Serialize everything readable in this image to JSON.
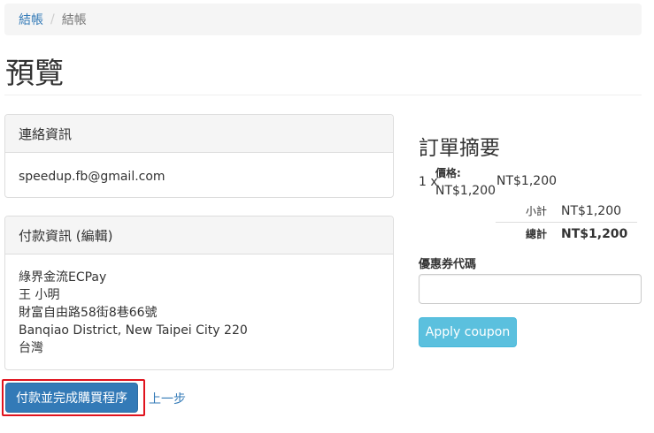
{
  "breadcrumb": {
    "link": "結帳",
    "separator": "/",
    "current": "結帳"
  },
  "page_title": "預覽",
  "contact_panel": {
    "heading": "連絡資訊",
    "email": "speedup.fb@gmail.com"
  },
  "payment_panel": {
    "heading": "付款資訊 (編輯)",
    "lines": [
      "綠界金流ECPay",
      "王 小明",
      "財富自由路58街8巷66號",
      "Banqiao District, New Taipei City 220",
      "台灣"
    ]
  },
  "actions": {
    "submit_label": "付款並完成購買程序",
    "back_label": "上一步"
  },
  "summary": {
    "title": "訂單摘要",
    "item": {
      "qty": "1 x",
      "price_label": "價格:",
      "price_value": "NT$1,200",
      "line_total": "NT$1,200"
    },
    "subtotal_label": "小計",
    "subtotal_value": "NT$1,200",
    "total_label": "總計",
    "total_value": "NT$1,200"
  },
  "coupon": {
    "label": "優惠券代碼",
    "value": "",
    "button_label": "Apply coupon"
  },
  "colors": {
    "primary": "#337ab7",
    "info": "#5bc0de",
    "highlight": "#e0131d"
  }
}
